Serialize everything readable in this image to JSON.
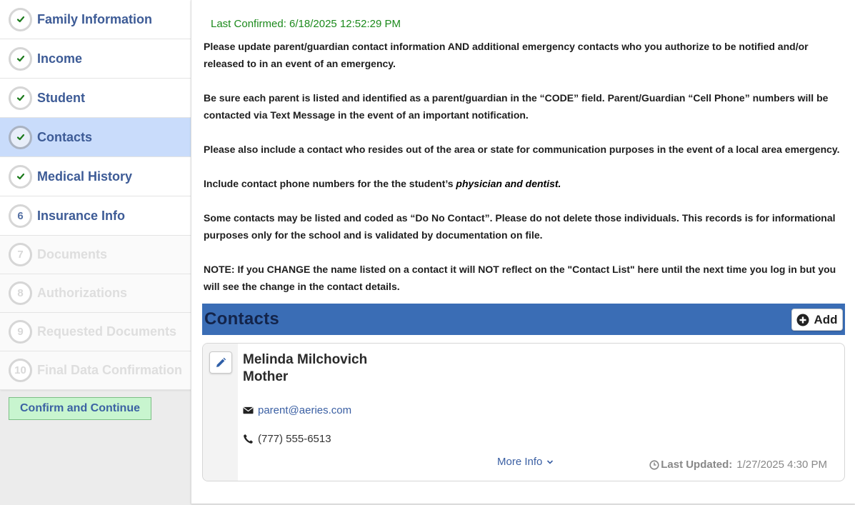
{
  "sidebar": {
    "steps": [
      {
        "label": "Family Information",
        "status": "complete",
        "icon": "check-icon"
      },
      {
        "label": "Income",
        "status": "complete",
        "icon": "check-icon"
      },
      {
        "label": "Student",
        "status": "complete",
        "icon": "check-icon"
      },
      {
        "label": "Contacts",
        "status": "complete-active",
        "icon": "check-icon"
      },
      {
        "label": "Medical History",
        "status": "complete",
        "icon": "check-icon"
      },
      {
        "number": "6",
        "label": "Insurance Info",
        "status": "available"
      },
      {
        "number": "7",
        "label": "Documents",
        "status": "locked"
      },
      {
        "number": "8",
        "label": "Authorizations",
        "status": "locked"
      },
      {
        "number": "9",
        "label": "Requested Documents",
        "status": "locked"
      },
      {
        "number": "10",
        "label": "Final Data Confirmation",
        "status": "locked"
      }
    ],
    "confirm_button": "Confirm and Continue"
  },
  "main": {
    "last_confirmed": "Last Confirmed: 6/18/2025 12:52:29 PM",
    "instructions": {
      "p1": "Please update parent/guardian contact information AND additional emergency contacts who you authorize to be notified and/or released to in an event of an emergency.",
      "p2": "Be sure each parent is listed and identified as a parent/guardian in the “CODE” field. Parent/Guardian “Cell Phone” numbers will be contacted via Text Message in the event of an important notification.",
      "p3": "Please also include a contact who resides out of the area or state for communication purposes in the event of a local area emergency.",
      "p4_prefix": "Include contact phone numbers for the the student’s ",
      "p4_emphasis": "physician and dentist.",
      "p5": "Some contacts may be listed and coded as “Do No Contact”. Please do not delete those individuals. This records is for informational purposes only for the school and is validated by documentation on file.",
      "p6": "NOTE: If you CHANGE the name listed on a contact it will NOT reflect on the \"Contact List\" here until the next time you log in but you will see the change in the contact details."
    },
    "contacts_section": {
      "title": "Contacts",
      "add_label": "Add"
    },
    "contact_card": {
      "name": "Melinda Milchovich",
      "relationship": "Mother",
      "email": "parent@aeries.com",
      "phone": "(777) 555-6513",
      "more_info": "More Info",
      "last_updated_label": "Last Updated:",
      "last_updated_value": "1/27/2025 4:30 PM"
    }
  },
  "colors": {
    "accent_blue": "#3a6db5",
    "active_step_bg": "#c9dcfb",
    "confirm_green": "#c8f5cf",
    "last_confirmed_green": "#1c8a1c",
    "check_green": "#1b7a1b"
  }
}
